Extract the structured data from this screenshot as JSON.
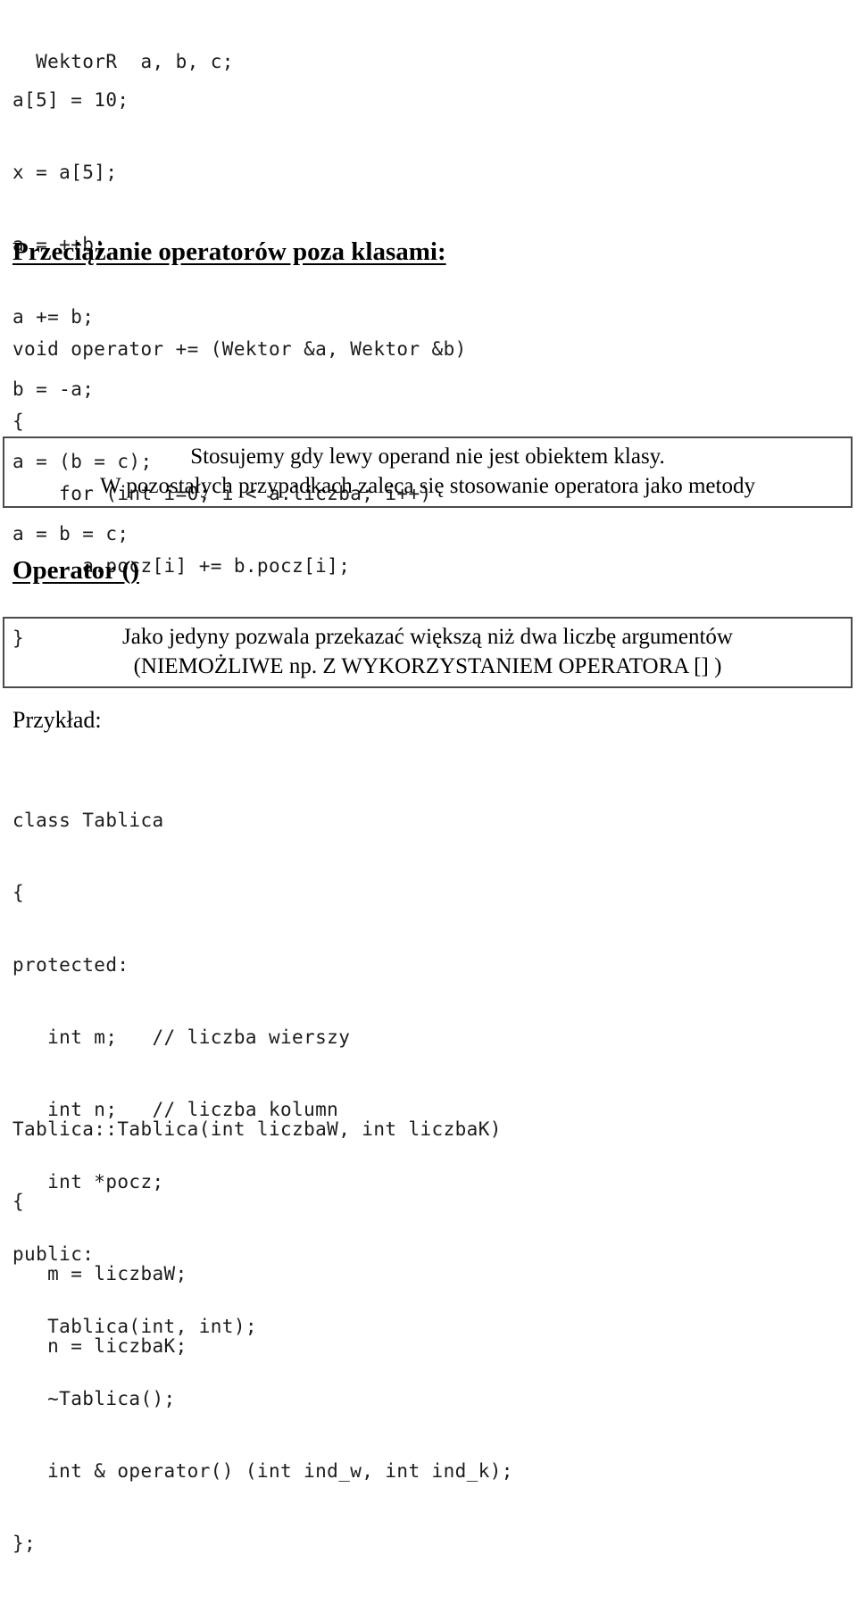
{
  "document": {
    "language": "pl",
    "page_background": "#ffffff",
    "text_color": "#0a0a0a",
    "box_border_color": "#4a4a4a"
  },
  "blocks": {
    "declaration": {
      "lines": [
        "  WektorR  a, b, c;"
      ]
    },
    "usage": {
      "lines": [
        "a[5] = 10;",
        "x = a[5];",
        "a = ++b;",
        "a += b;",
        "b = -a;",
        "a = (b = c);",
        "a = b = c;"
      ]
    },
    "global_operator": {
      "lines": [
        "void operator += (Wektor &a, Wektor &b)",
        "{",
        "    for (int i=0; i < a.liczba; i++)",
        "      a.pocz[i] += b.pocz[i];",
        "}"
      ]
    },
    "class_tablica": {
      "lines": [
        "class Tablica",
        "{",
        "protected:",
        "   int m;   // liczba wierszy",
        "   int n;   // liczba kolumn",
        "   int *pocz;",
        "public:",
        "   Tablica(int, int);",
        "   ~Tablica();",
        "   int & operator() (int ind_w, int ind_k);",
        "};"
      ]
    },
    "constructor_tablica": {
      "lines": [
        "Tablica::Tablica(int liczbaW, int liczbaK)",
        "{",
        "   m = liczbaW;",
        "   n = liczbaK;"
      ]
    }
  },
  "headings": {
    "overloading_outside_classes": "Przeciążanie operatorów poza klasami:",
    "operator_call": "Operator ()",
    "example": "Przykład:"
  },
  "callouts": {
    "usage_note": {
      "line1": "Stosujemy gdy lewy operand nie jest obiektem klasy.",
      "line2": "W pozostałych przypadkach zaleca się stosowanie operatora jako metody"
    },
    "args_note": {
      "line1": "Jako jedyny pozwala przekazać większą niż dwa liczbę argumentów",
      "line2": "(NIEMOŻLIWE np. Z WYKORZYSTANIEM OPERATORA [] )"
    }
  }
}
